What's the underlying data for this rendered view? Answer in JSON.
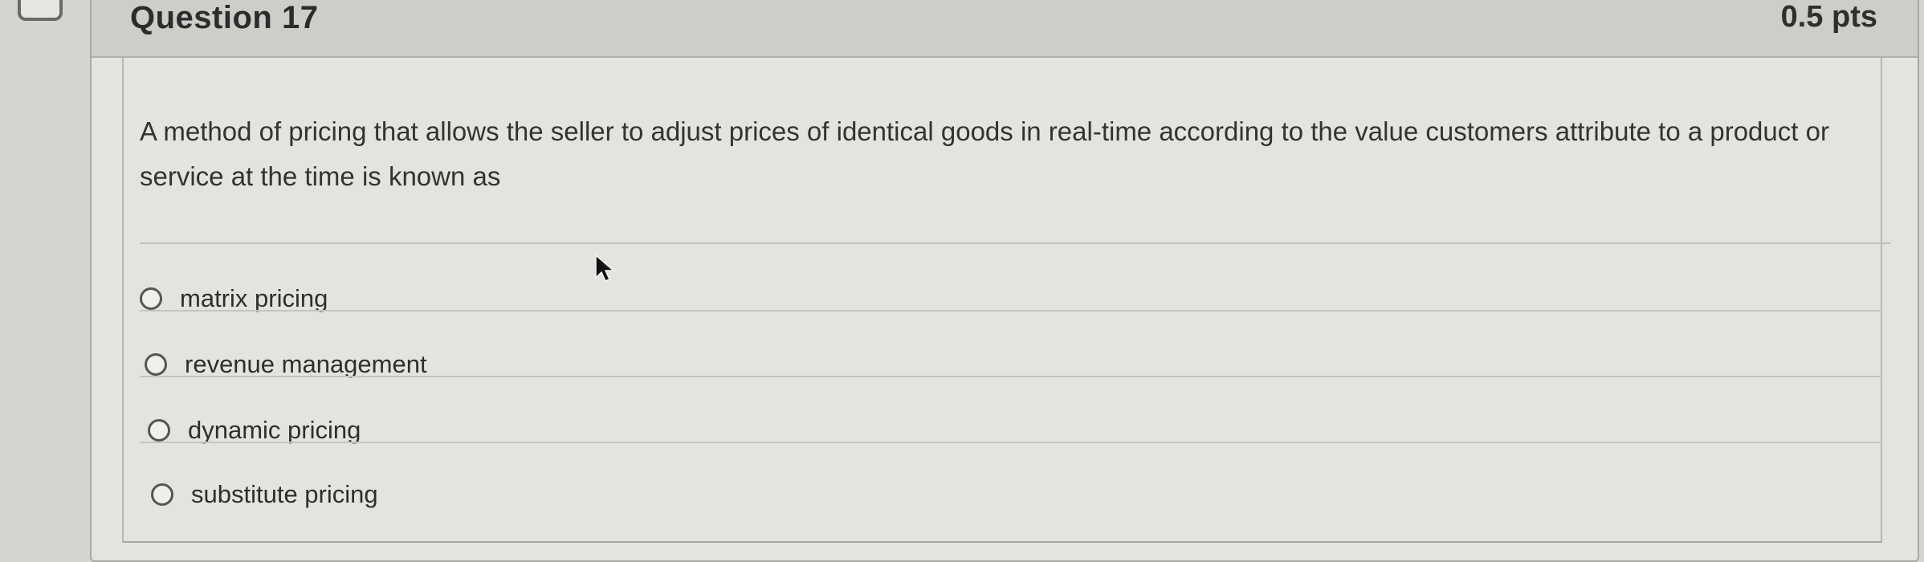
{
  "question": {
    "title": "Question 17",
    "points": "0.5 pts",
    "text": "A method of pricing that allows the seller to adjust prices of identical goods in real-time according to the value customers attribute to a product or service at the time is known as"
  },
  "answers": [
    {
      "label": "matrix pricing",
      "selected": false
    },
    {
      "label": "revenue management",
      "selected": false
    },
    {
      "label": "dynamic pricing",
      "selected": false
    },
    {
      "label": "substitute pricing",
      "selected": false
    }
  ],
  "icons": {
    "flag": "flag-icon",
    "cursor": "mouse-pointer-icon"
  }
}
